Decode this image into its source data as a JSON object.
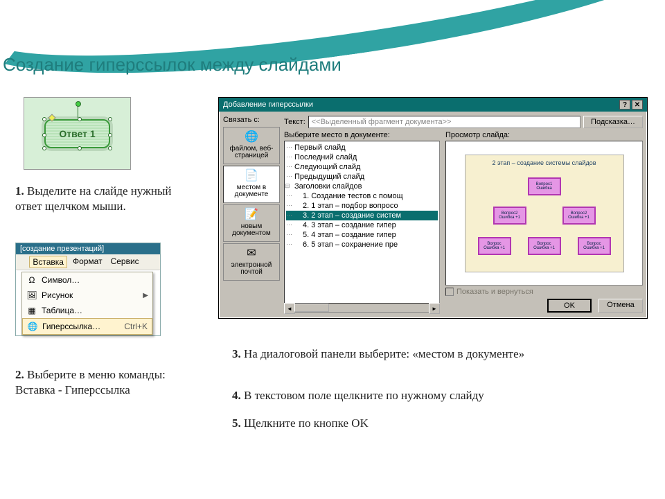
{
  "title": "Создание гиперссылок между слайдами",
  "shape": {
    "label": "Ответ 1"
  },
  "steps": {
    "s1_num": "1.",
    "s1": "Выделите на слайде нужный ответ щелчком мыши.",
    "s2_num": "2.",
    "s2_a": "Выберите в меню команды:",
    "s2_b": "Вставка - Гиперссылка",
    "s3_num": "3.",
    "s3": "На диалоговой панели выберите: «местом в документе»",
    "s4_num": "4.",
    "s4": "В текстовом поле щелкните по нужному слайду",
    "s5_num": "5.",
    "s5": "Щелкните по кнопке OK"
  },
  "menu": {
    "window_title": "[создание презентаций]",
    "items": [
      "Вставка",
      "Формат",
      "Сервис"
    ],
    "dd": {
      "symbol": "Символ…",
      "picture": "Рисунок",
      "table": "Таблица…",
      "hyperlink": "Гиперссылка…",
      "hyperlink_shortcut": "Ctrl+K"
    }
  },
  "dialog": {
    "title": "Добавление гиперссылки",
    "link_to_label": "Связать с:",
    "text_label": "Текст:",
    "text_value": "<<Выделенный фрагмент документа>>",
    "tip_btn": "Подсказка…",
    "nav": [
      {
        "id": "file",
        "label": "файлом, веб-страницей"
      },
      {
        "id": "place",
        "label": "местом в документе",
        "selected": true
      },
      {
        "id": "new",
        "label": "новым документом"
      },
      {
        "id": "email",
        "label": "электронной почтой"
      }
    ],
    "tree_label": "Выберите место в документе:",
    "preview_label": "Просмотр слайда:",
    "tree": {
      "first": "Первый слайд",
      "last": "Последний слайд",
      "next": "Следующий слайд",
      "prev": "Предыдущий слайд",
      "headers": "Заголовки слайдов",
      "items": [
        "1. Создание тестов с помощ",
        "2. 1 этап – подбор вопросо",
        "3. 2 этап – создание систем",
        "4. 3 этап – создание гипер",
        "5. 4 этап – создание гипер",
        "6. 5 этап – сохранение пре"
      ],
      "selected_index": 2
    },
    "preview_slide": {
      "title": "2 этап – создание системы слайдов",
      "cards": [
        {
          "l1": "Вопрос1",
          "l2": "Ошибка"
        },
        {
          "l1": "Вопрос2",
          "l2": "Ошибка +1"
        },
        {
          "l1": "Вопрос2",
          "l2": "Ошибка +1"
        },
        {
          "l1": "Вопрос",
          "l2": "Ошибка +1"
        },
        {
          "l1": "Вопрос",
          "l2": "Ошибка +1"
        },
        {
          "l1": "Вопрос",
          "l2": "Ошибка +1"
        }
      ]
    },
    "show_return": "Показать и вернуться",
    "ok": "OK",
    "cancel": "Отмена"
  }
}
